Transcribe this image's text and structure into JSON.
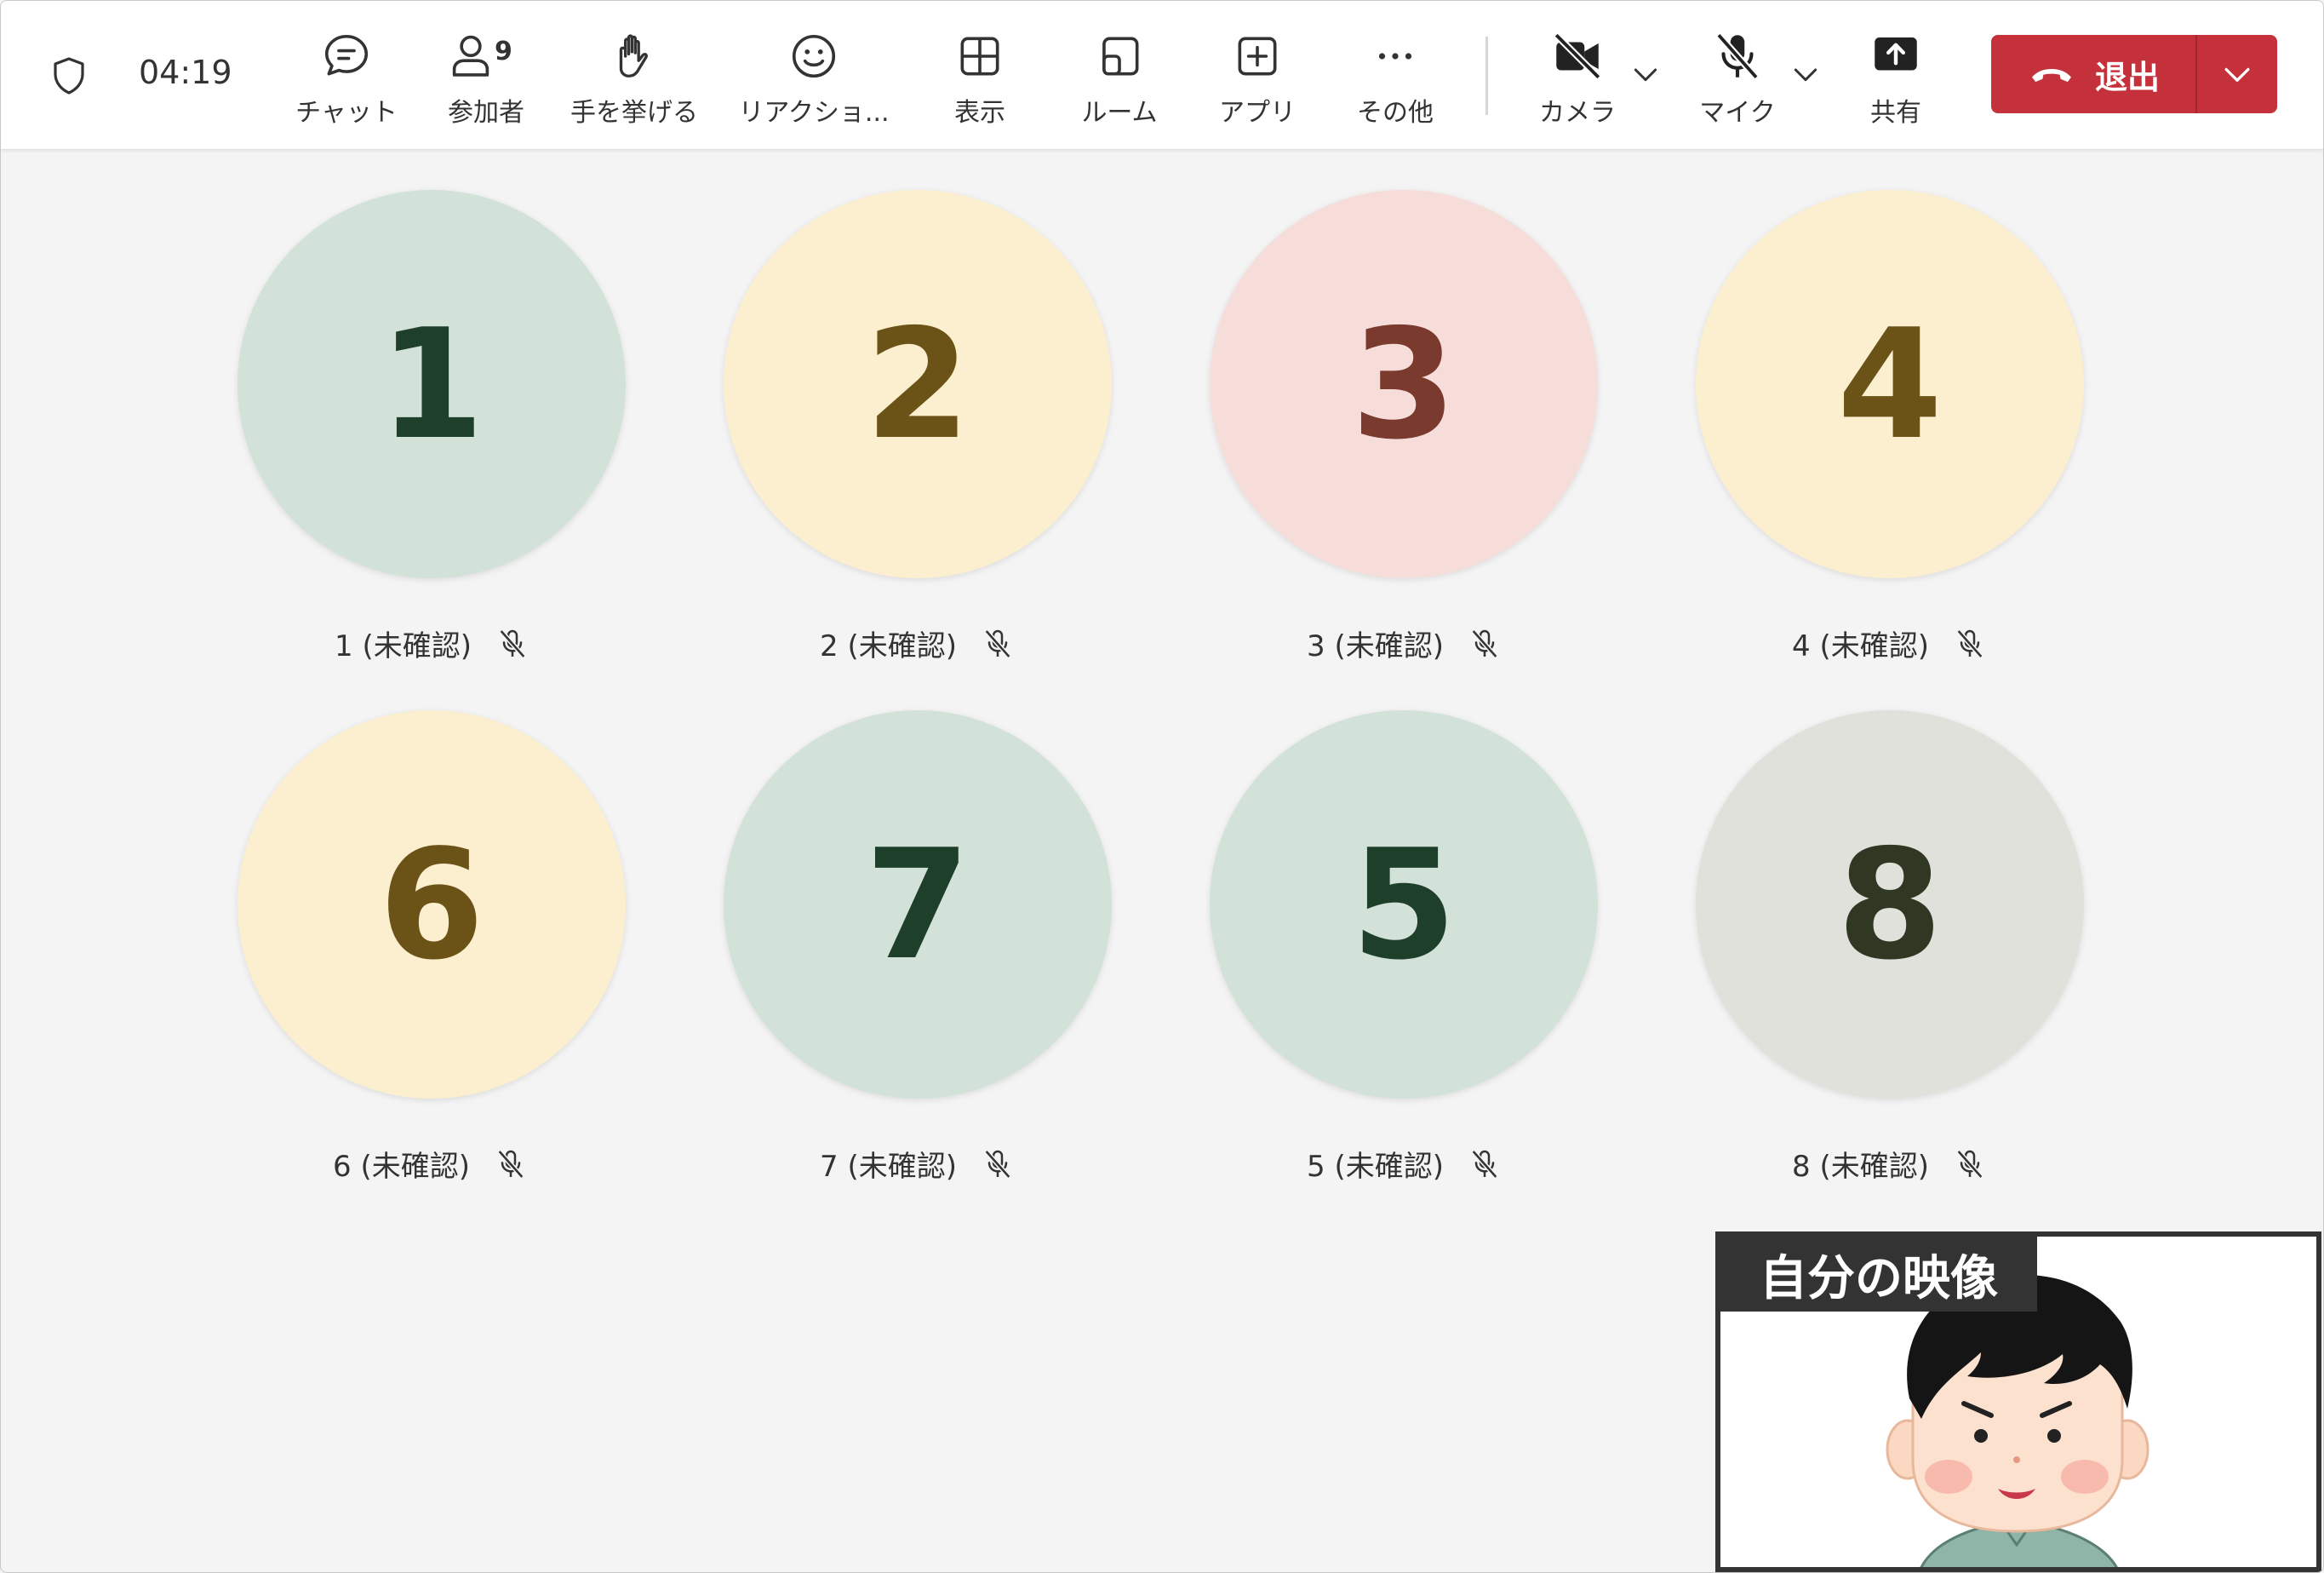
{
  "toolbar": {
    "timer": "04:19",
    "chat_label": "チャット",
    "participants_label": "参加者",
    "participants_count": "9",
    "raise_hand_label": "手を挙げる",
    "reactions_label": "リアクショ...",
    "view_label": "表示",
    "rooms_label": "ルーム",
    "apps_label": "アプリ",
    "more_label": "その他",
    "camera_label": "カメラ",
    "mic_label": "マイク",
    "share_label": "共有",
    "leave_label": "退出"
  },
  "participants": [
    {
      "number": "1",
      "name": "1 (未確認)",
      "bg": "#d3e2d9",
      "fg": "#1e3f2a"
    },
    {
      "number": "2",
      "name": "2 (未確認)",
      "bg": "#fcefcf",
      "fg": "#6b5217"
    },
    {
      "number": "3",
      "name": "3 (未確認)",
      "bg": "#f6ddda",
      "fg": "#7a3a2e"
    },
    {
      "number": "4",
      "name": "4 (未確認)",
      "bg": "#fcefcf",
      "fg": "#6b5217"
    },
    {
      "number": "6",
      "name": "6 (未確認)",
      "bg": "#fcefcf",
      "fg": "#6b5217"
    },
    {
      "number": "7",
      "name": "7 (未確認)",
      "bg": "#d3e2d9",
      "fg": "#1e3f2a"
    },
    {
      "number": "5",
      "name": "5 (未確認)",
      "bg": "#d3e2d9",
      "fg": "#1e3f2a"
    },
    {
      "number": "8",
      "name": "8 (未確認)",
      "bg": "#dfe1da",
      "fg": "#303824"
    }
  ],
  "self_view": {
    "label": "自分の映像"
  },
  "colors": {
    "leave_red": "#c4313b",
    "background": "#f4f4f4"
  }
}
